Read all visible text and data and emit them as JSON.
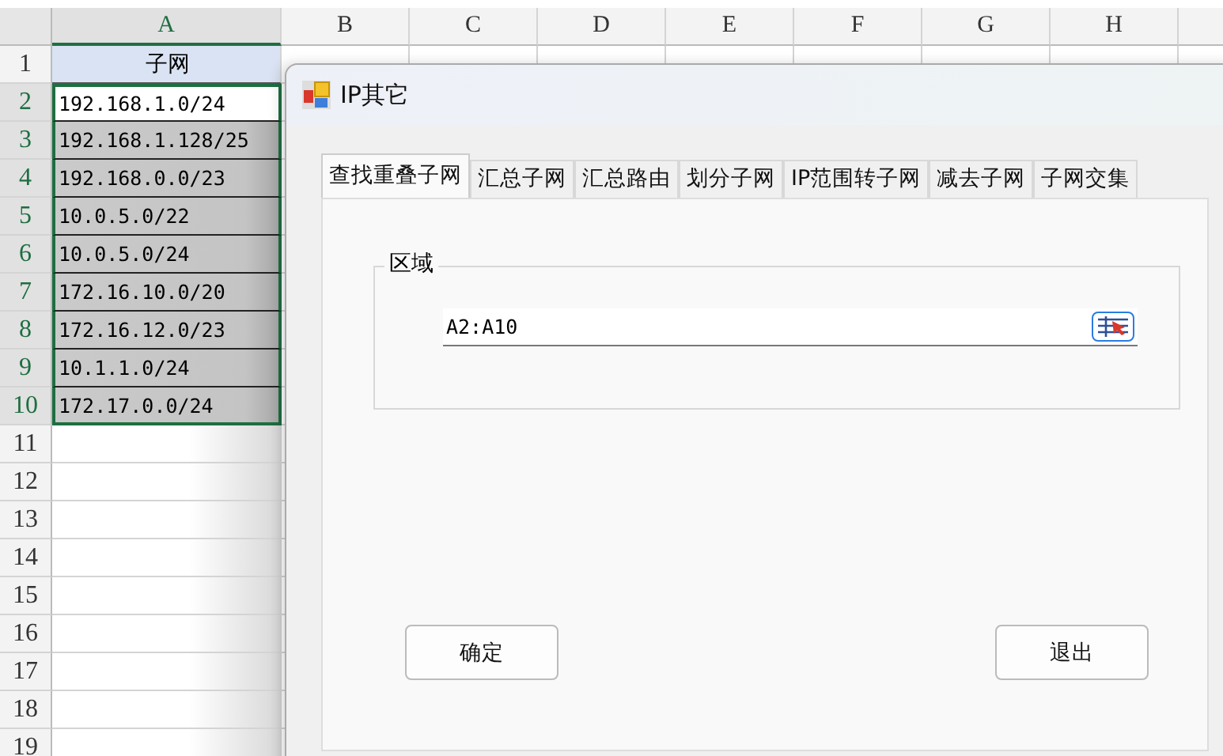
{
  "sheet": {
    "columns": [
      {
        "label": "A",
        "selected": true
      },
      {
        "label": "B",
        "selected": false
      },
      {
        "label": "C",
        "selected": false
      },
      {
        "label": "D",
        "selected": false
      },
      {
        "label": "E",
        "selected": false
      },
      {
        "label": "F",
        "selected": false
      },
      {
        "label": "G",
        "selected": false
      },
      {
        "label": "H",
        "selected": false
      }
    ],
    "rows": [
      {
        "number": "1",
        "selected": false,
        "cell": "子网",
        "kind": "header"
      },
      {
        "number": "2",
        "selected": true,
        "cell": "192.168.1.0/24",
        "kind": "active"
      },
      {
        "number": "3",
        "selected": true,
        "cell": "192.168.1.128/25",
        "kind": "range"
      },
      {
        "number": "4",
        "selected": true,
        "cell": "192.168.0.0/23",
        "kind": "range"
      },
      {
        "number": "5",
        "selected": true,
        "cell": "10.0.5.0/22",
        "kind": "range"
      },
      {
        "number": "6",
        "selected": true,
        "cell": "10.0.5.0/24",
        "kind": "range"
      },
      {
        "number": "7",
        "selected": true,
        "cell": "172.16.10.0/20",
        "kind": "range"
      },
      {
        "number": "8",
        "selected": true,
        "cell": "172.16.12.0/23",
        "kind": "range"
      },
      {
        "number": "9",
        "selected": true,
        "cell": "10.1.1.0/24",
        "kind": "range"
      },
      {
        "number": "10",
        "selected": true,
        "cell": "172.17.0.0/24",
        "kind": "range"
      },
      {
        "number": "11",
        "selected": false,
        "kind": "empty"
      },
      {
        "number": "12",
        "selected": false,
        "kind": "empty"
      },
      {
        "number": "13",
        "selected": false,
        "kind": "empty"
      },
      {
        "number": "14",
        "selected": false,
        "kind": "empty"
      },
      {
        "number": "15",
        "selected": false,
        "kind": "empty"
      },
      {
        "number": "16",
        "selected": false,
        "kind": "empty"
      },
      {
        "number": "17",
        "selected": false,
        "kind": "empty"
      },
      {
        "number": "18",
        "selected": false,
        "kind": "empty"
      },
      {
        "number": "19",
        "selected": false,
        "kind": "empty"
      }
    ]
  },
  "dialog": {
    "title": "IP其它",
    "tabs": [
      {
        "label": "查找重叠子网",
        "selected": true
      },
      {
        "label": "汇总子网",
        "selected": false
      },
      {
        "label": "汇总路由",
        "selected": false
      },
      {
        "label": "划分子网",
        "selected": false
      },
      {
        "label": "IP范围转子网",
        "selected": false
      },
      {
        "label": "减去子网",
        "selected": false
      },
      {
        "label": "子网交集",
        "selected": false
      }
    ],
    "group": {
      "label": "区域",
      "value": "A2:A10"
    },
    "buttons": [
      "确定",
      "退出"
    ]
  }
}
